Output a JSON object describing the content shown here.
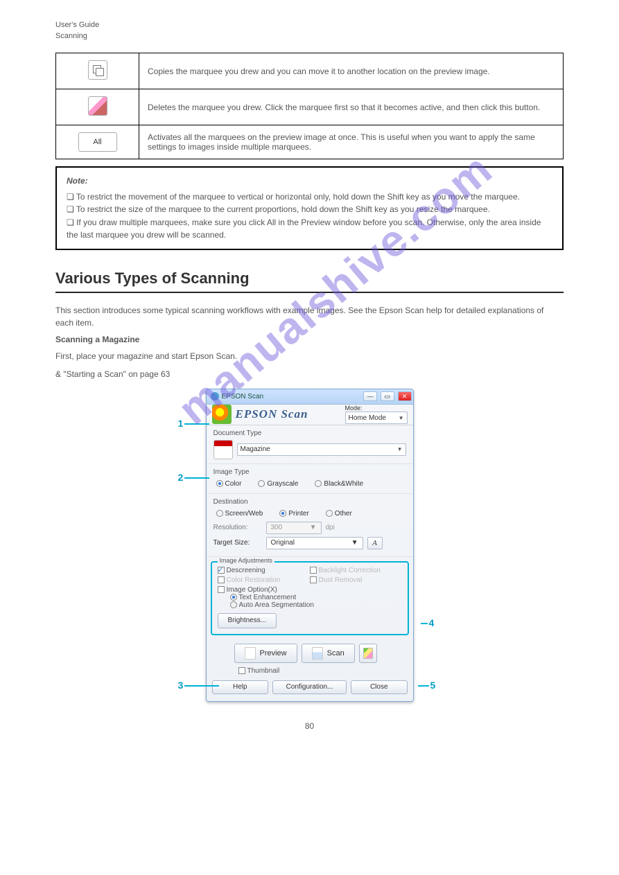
{
  "header_title": "User's Guide",
  "header_section": "Scanning",
  "icontable": {
    "row1_text": "Copies the marquee you drew and you can move it to another location on the preview image.",
    "row2_text": "Deletes the marquee you drew. Click the marquee first so that it becomes active, and then click this button.",
    "row3_btn": "All",
    "row3_text": "Activates all the marquees on the preview image at once. This is useful when you want to apply the same settings to images inside multiple marquees."
  },
  "note": {
    "label": "Note:",
    "l1": "❏ To restrict the movement of the marquee to vertical or horizontal only, hold down the Shift key as you move the marquee.",
    "l2": "❏ To restrict the size of the marquee to the current proportions, hold down the Shift key as you resize the marquee.",
    "l3": "❏ If you draw multiple marquees, make sure you click All in the Preview window before you scan. Otherwise, only the area inside the last marquee you drew will be scanned."
  },
  "h1": "Various Types of Scanning",
  "para1": "This section introduces some typical scanning workflows with example images. See the Epson Scan help for detailed explanations of each item.",
  "sec_label": "Scanning a Magazine",
  "para2": "First, place your magazine and start Epson Scan.",
  "link": "& \"Starting a Scan\" on page 63",
  "shot": {
    "title": "EPSON Scan",
    "logo": "EPSON Scan",
    "mode_label": "Mode:",
    "mode_value": "Home Mode",
    "doc_type_label": "Document Type",
    "doc_type_value": "Magazine",
    "image_type_label": "Image Type",
    "image_type_color": "Color",
    "image_type_gray": "Grayscale",
    "image_type_bw": "Black&White",
    "dest_label": "Destination",
    "dest_screen": "Screen/Web",
    "dest_printer": "Printer",
    "dest_other": "Other",
    "res_label": "Resolution:",
    "res_value": "300",
    "res_unit": "dpi",
    "size_label": "Target Size:",
    "size_value": "Original",
    "adj_title": "Image Adjustments",
    "adj_descreening": "Descreening",
    "adj_backlight": "Backlight Correction",
    "adj_color_rest": "Color Restoration",
    "adj_dust": "Dust Removal",
    "adj_imgopt": "Image Option(X)",
    "adj_text_enh": "Text Enhancement",
    "adj_autoarea": "Auto Area Segmentation",
    "adj_brightness": "Brightness...",
    "btn_preview": "Preview",
    "btn_scan": "Scan",
    "cb_thumb": "Thumbnail",
    "btn_help": "Help",
    "btn_config": "Configuration...",
    "btn_close": "Close"
  },
  "callouts": {
    "c1": "1",
    "c2": "2",
    "c3": "3",
    "c4": "4",
    "c5": "5"
  },
  "watermark": "manualshive.com",
  "pagenum": "80"
}
